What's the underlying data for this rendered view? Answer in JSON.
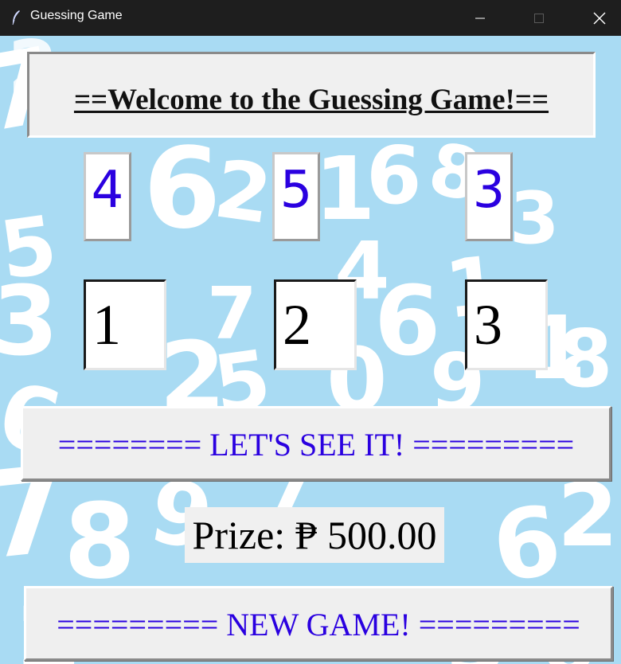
{
  "window": {
    "title": "Guessing Game",
    "minimize_icon": "minimize-icon",
    "maximize_icon": "maximize-icon",
    "close_icon": "close-icon"
  },
  "welcome_text": "==Welcome to the Guessing Game!==",
  "target_digits": [
    "4",
    "5",
    "3"
  ],
  "guess_inputs": [
    "1",
    "2",
    "3"
  ],
  "check_button_label": "======== LET'S SEE IT! =========",
  "prize_text": "Prize: ₱ 500.00",
  "new_game_button_label": "========= NEW GAME! =========",
  "colors": {
    "background": "#a9dbf3",
    "digit_text": "#2a00e0",
    "button_text": "#2a00e0",
    "titlebar": "#1e1e1e"
  }
}
